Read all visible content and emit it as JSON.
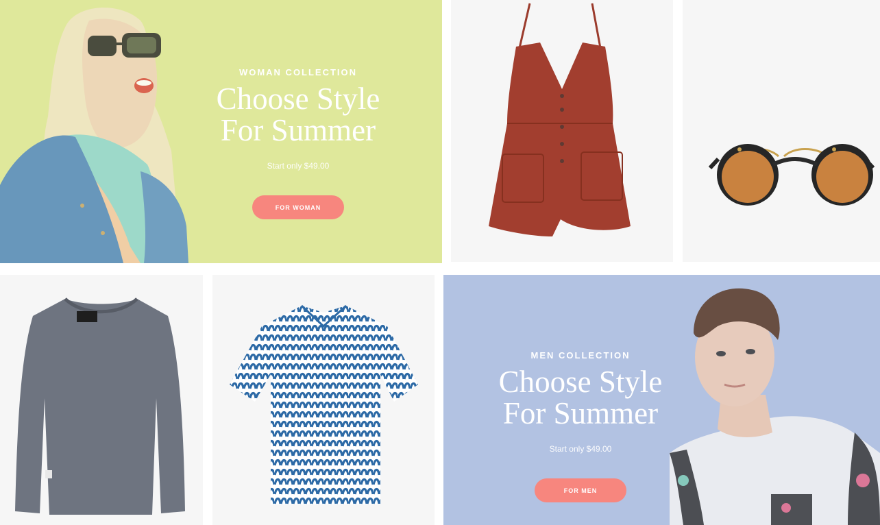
{
  "woman_banner": {
    "kicker": "WOMAN COLLECTION",
    "headline_line1": "Choose Style",
    "headline_line2": "For Summer",
    "price": "Start only $49.00",
    "button": "FOR WOMAN",
    "bg_color": "#e0e89b"
  },
  "men_banner": {
    "kicker": "MEN COLLECTION",
    "headline_line1": "Choose Style",
    "headline_line2": "For Summer",
    "price": "Start only $49.00",
    "button": "FOR MEN",
    "bg_color": "#b2c2e2"
  },
  "theme": {
    "button_color": "#f7867e",
    "product_bg": "#f6f6f6"
  }
}
